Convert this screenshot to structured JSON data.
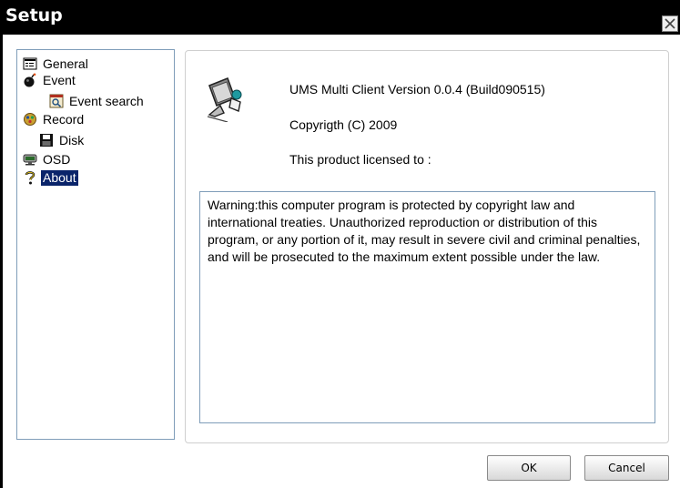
{
  "window": {
    "title": "Setup"
  },
  "tree": {
    "items": [
      {
        "label": "General",
        "icon": "general-icon"
      },
      {
        "label": "Event",
        "icon": "bomb-icon"
      },
      {
        "label": "Event search",
        "icon": "event-search-icon"
      },
      {
        "label": "Record",
        "icon": "record-icon"
      },
      {
        "label": "Disk",
        "icon": "floppy-disk-icon"
      },
      {
        "label": "OSD",
        "icon": "osd-icon"
      },
      {
        "label": "About",
        "icon": "question-mark-icon",
        "selected": true
      }
    ]
  },
  "about": {
    "icon": "computer-icon",
    "version": "UMS Multi Client Version 0.0.4 (Build090515)",
    "copyright": "Copyrigth (C) 2009",
    "licensed": "This product licensed to :",
    "warning": "Warning:this computer program is protected by copyright law and international treaties. Unauthorized reproduction or distribution of this program, or any portion of it, may result in severe civil and criminal penalties, and will be prosecuted to the maximum extent possible under the law."
  },
  "buttons": {
    "ok": "OK",
    "cancel": "Cancel"
  },
  "colors": {
    "titlebar": "#000000",
    "selection": "#0a246a",
    "panel_border": "#7f9db9"
  }
}
